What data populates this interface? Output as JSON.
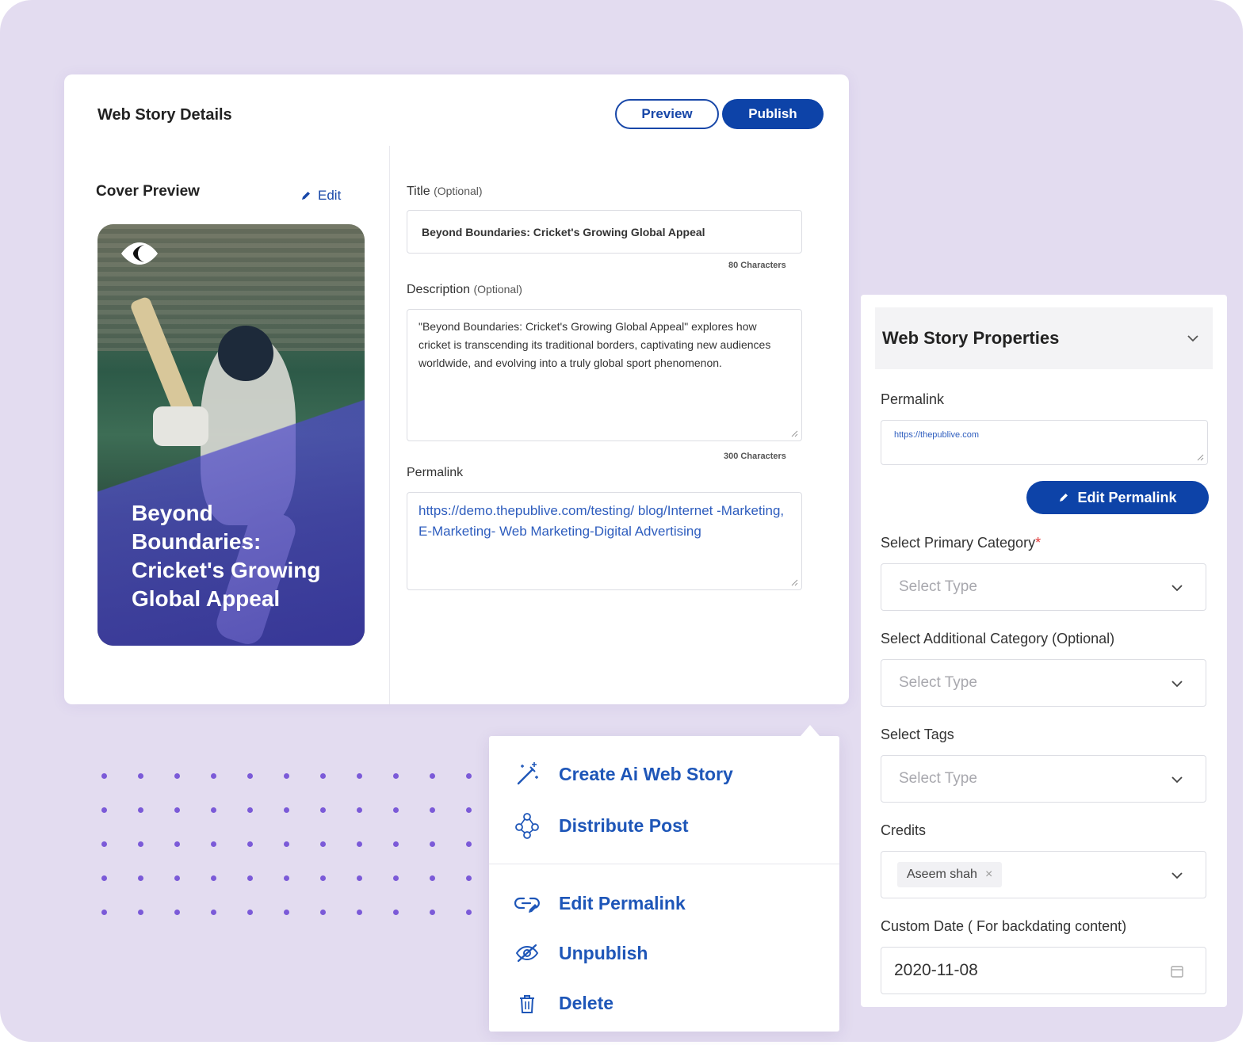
{
  "main": {
    "title": "Web Story Details",
    "preview_label": "Preview",
    "publish_label": "Publish",
    "cover_label": "Cover Preview",
    "cover_edit_label": "Edit",
    "cover_title": "Beyond Boundaries: Cricket's Growing Global Appeal",
    "title_field": {
      "label": "Title",
      "optional": "(Optional)",
      "value": "Beyond Boundaries: Cricket's Growing Global Appeal",
      "count": "80 Characters"
    },
    "description_field": {
      "label": "Description",
      "optional": "(Optional)",
      "value": "\"Beyond Boundaries: Cricket's Growing Global Appeal\" explores how cricket is transcending its traditional borders, captivating new audiences worldwide, and evolving into a truly global sport phenomenon.",
      "count": "300 Characters"
    },
    "permalink_field": {
      "label": "Permalink",
      "value": "https://demo.thepublive.com/testing/ blog/Internet -Marketing, E-Marketing- Web Marketing-Digital Advertising"
    }
  },
  "properties": {
    "title": "Web Story Properties",
    "permalink_label": "Permalink",
    "permalink_value": "https://thepublive.com",
    "edit_permalink_label": "Edit Permalink",
    "primary_category_label": "Select Primary Category",
    "primary_category_required": "*",
    "primary_category_placeholder": "Select Type",
    "additional_category_label": "Select Additional Category (Optional)",
    "additional_category_placeholder": "Select Type",
    "tags_label": "Select Tags",
    "tags_placeholder": "Select Type",
    "credits_label": "Credits",
    "credits_chip": "Aseem shah",
    "credits_chip_remove": "×",
    "custom_date_label": "Custom Date ( For backdating content)",
    "custom_date_value": "2020-11-08"
  },
  "menu": {
    "items": [
      {
        "label": "Create Ai Web Story",
        "icon": "magic-wand-icon"
      },
      {
        "label": "Distribute Post",
        "icon": "share-network-icon"
      },
      {
        "label": "Edit Permalink",
        "icon": "link-edit-icon"
      },
      {
        "label": "Unpublish",
        "icon": "eye-off-icon"
      },
      {
        "label": "Delete",
        "icon": "trash-icon"
      }
    ]
  },
  "colors": {
    "background": "#e3dcf0",
    "primary": "#0d43a8",
    "link": "#2e5dbe",
    "dots": "#7b5ad8",
    "cover_overlay": "#504bc8"
  }
}
